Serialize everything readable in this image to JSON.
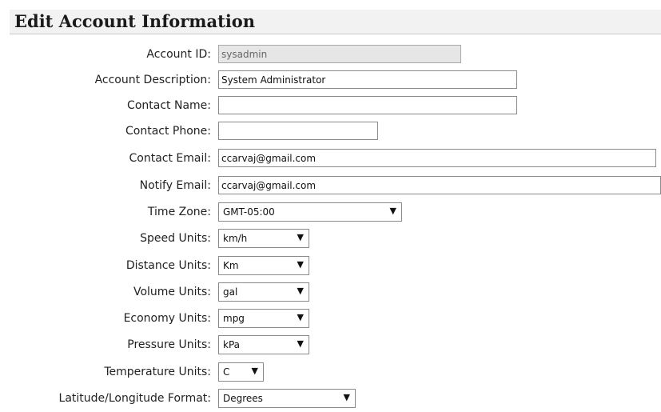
{
  "page": {
    "title": "Edit Account Information"
  },
  "fields": {
    "account_id": {
      "label": "Account ID:",
      "value": "sysadmin"
    },
    "account_description": {
      "label": "Account Description:",
      "value": "System Administrator"
    },
    "contact_name": {
      "label": "Contact Name:",
      "value": ""
    },
    "contact_phone": {
      "label": "Contact Phone:",
      "value": ""
    },
    "contact_email": {
      "label": "Contact Email:",
      "value": "ccarvaj@gmail.com"
    },
    "notify_email": {
      "label": "Notify Email:",
      "value": "ccarvaj@gmail.com"
    },
    "time_zone": {
      "label": "Time Zone:",
      "value": "GMT-05:00"
    },
    "speed_units": {
      "label": "Speed Units:",
      "value": "km/h"
    },
    "distance_units": {
      "label": "Distance Units:",
      "value": "Km"
    },
    "volume_units": {
      "label": "Volume Units:",
      "value": "gal"
    },
    "economy_units": {
      "label": "Economy Units:",
      "value": "mpg"
    },
    "pressure_units": {
      "label": "Pressure Units:",
      "value": "kPa"
    },
    "temperature_units": {
      "label": "Temperature Units:",
      "value": "C"
    },
    "latlon_format": {
      "label": "Latitude/Longitude Format:",
      "value": "Degrees"
    }
  },
  "icons": {
    "dropdown_arrow": "chevron-down-icon"
  }
}
